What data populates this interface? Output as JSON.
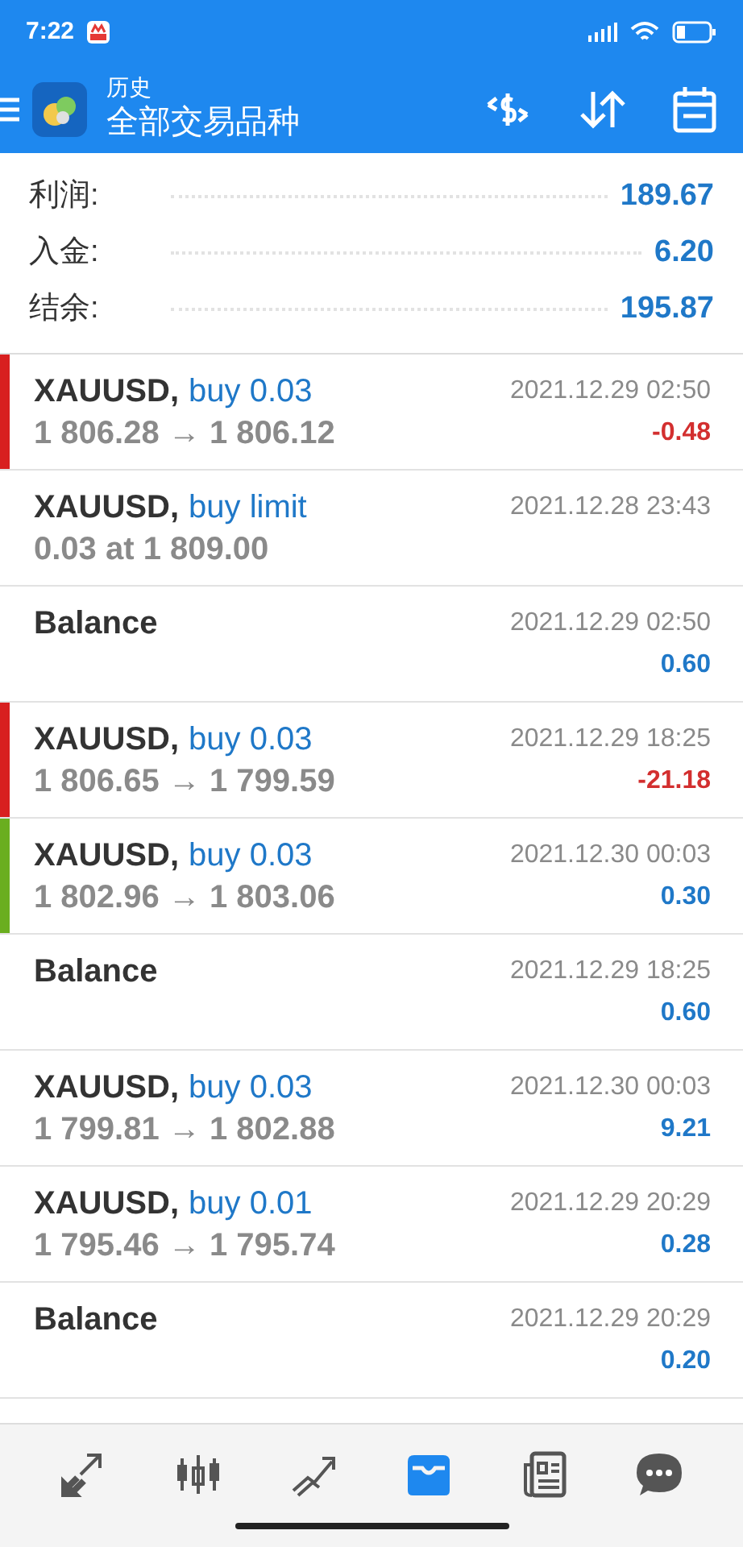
{
  "status_bar": {
    "time": "7:22"
  },
  "toolbar": {
    "subtitle": "历史",
    "title": "全部交易品种"
  },
  "summary": [
    {
      "label": "利润:",
      "value": "189.67"
    },
    {
      "label": "入金:",
      "value": "6.20"
    },
    {
      "label": "结余:",
      "value": "195.87"
    }
  ],
  "deals": [
    {
      "kind": "trade",
      "symbol": "XAUUSD,",
      "action": "buy 0.03",
      "prices": "1 806.28 → 1 806.12",
      "time": "2021.12.29 02:50",
      "profit": "-0.48",
      "loss": true,
      "color": "#d81f1f"
    },
    {
      "kind": "order",
      "symbol": "XAUUSD,",
      "action": "buy limit",
      "prices": "0.03 at 1 809.00",
      "time": "2021.12.28 23:43"
    },
    {
      "kind": "balance",
      "symbol": "Balance",
      "time": "2021.12.29 02:50",
      "profit": "0.60",
      "loss": false
    },
    {
      "kind": "trade",
      "symbol": "XAUUSD,",
      "action": "buy 0.03",
      "prices": "1 806.65 → 1 799.59",
      "time": "2021.12.29 18:25",
      "profit": "-21.18",
      "loss": true,
      "color": "#d81f1f"
    },
    {
      "kind": "trade",
      "symbol": "XAUUSD,",
      "action": "buy 0.03",
      "prices": "1 802.96 → 1 803.06",
      "time": "2021.12.30 00:03",
      "profit": "0.30",
      "loss": false,
      "color": "#6aae1f"
    },
    {
      "kind": "balance",
      "symbol": "Balance",
      "time": "2021.12.29 18:25",
      "profit": "0.60",
      "loss": false
    },
    {
      "kind": "trade",
      "symbol": "XAUUSD,",
      "action": "buy 0.03",
      "prices": "1 799.81 → 1 802.88",
      "time": "2021.12.30 00:03",
      "profit": "9.21",
      "loss": false
    },
    {
      "kind": "trade",
      "symbol": "XAUUSD,",
      "action": "buy 0.01",
      "prices": "1 795.46 → 1 795.74",
      "time": "2021.12.29 20:29",
      "profit": "0.28",
      "loss": false
    },
    {
      "kind": "balance",
      "symbol": "Balance",
      "time": "2021.12.29 20:29",
      "profit": "0.20",
      "loss": false
    }
  ],
  "nav": [
    {
      "kind": "trade",
      "selected": false
    },
    {
      "kind": "quotes",
      "selected": false
    },
    {
      "kind": "chart",
      "selected": false
    },
    {
      "kind": "history",
      "selected": true
    },
    {
      "kind": "news",
      "selected": false
    },
    {
      "kind": "chat",
      "selected": false
    }
  ]
}
